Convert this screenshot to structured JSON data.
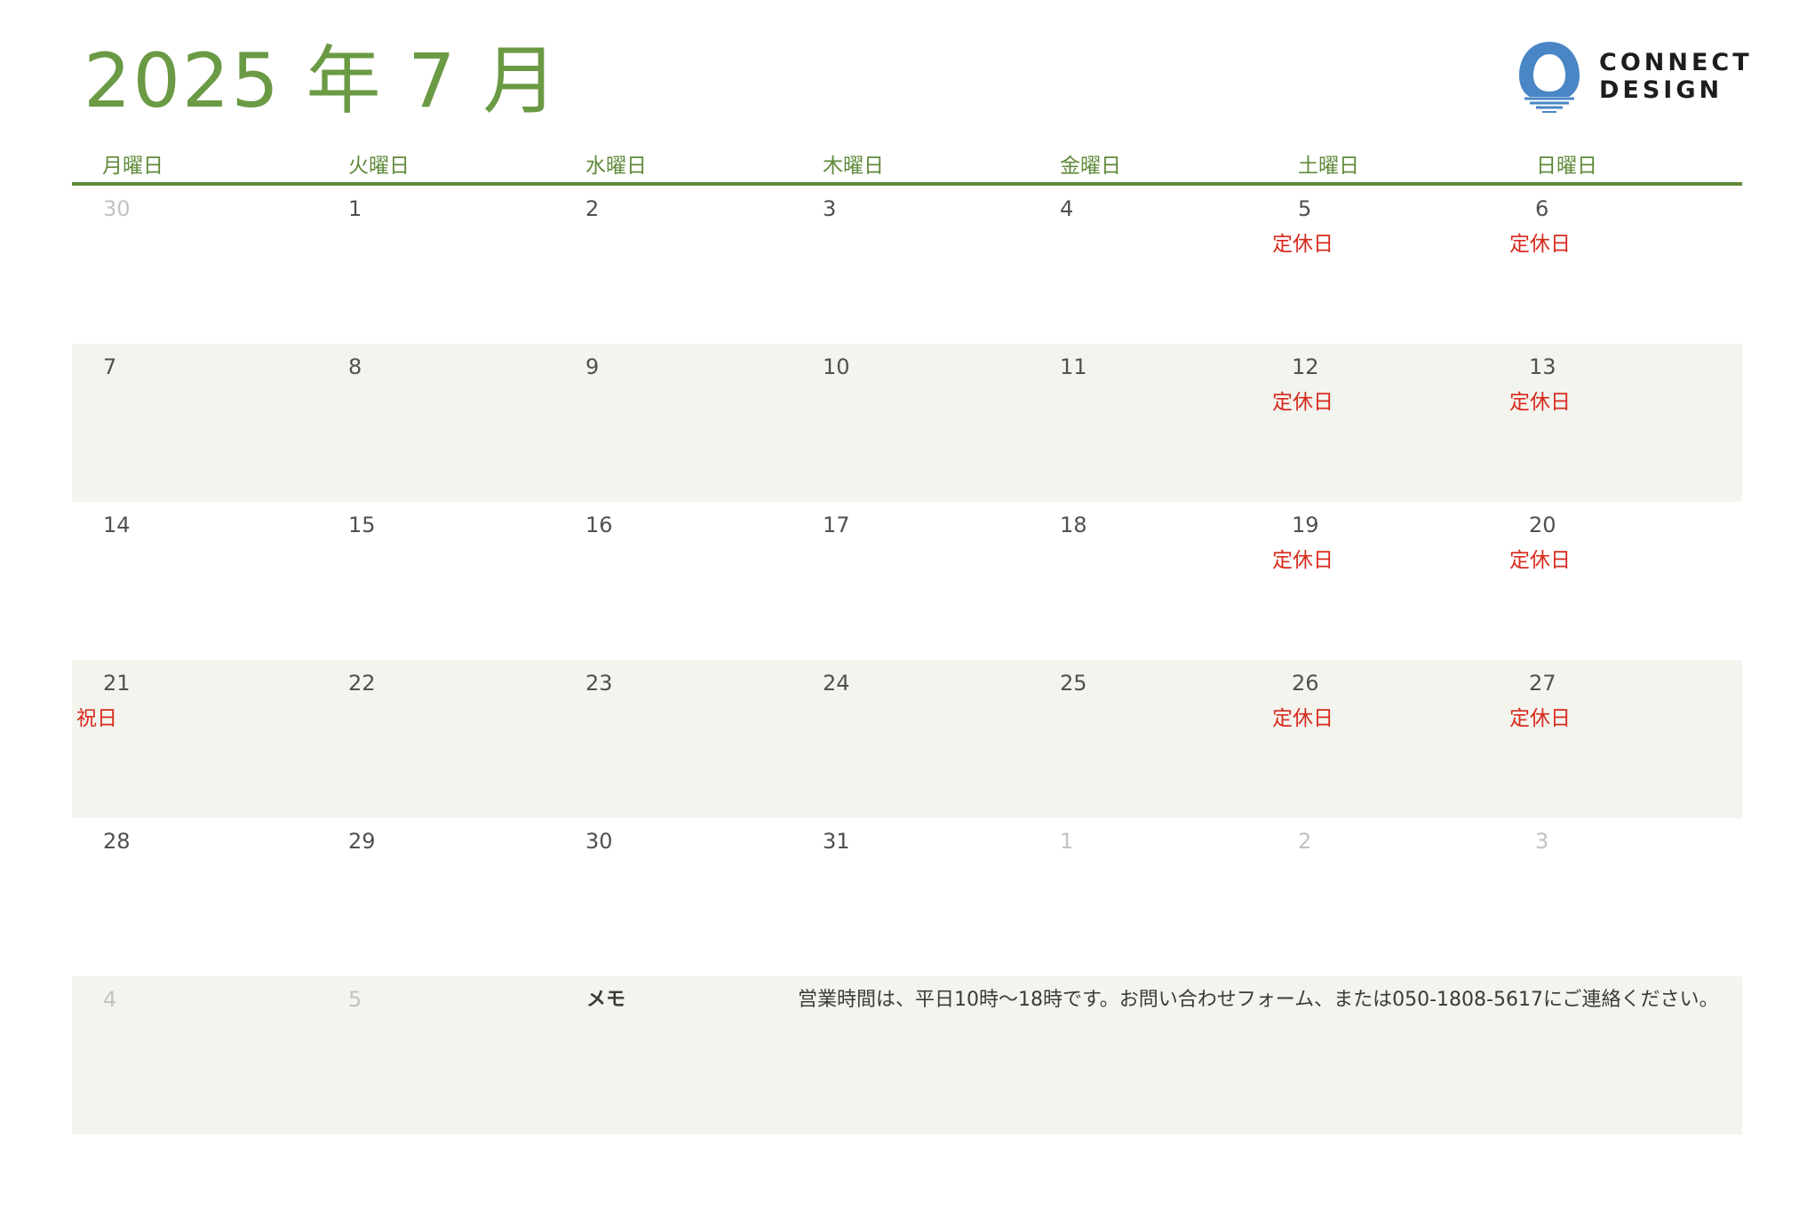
{
  "title": "2025 年 7 月",
  "brand": {
    "line1": "CONNECT",
    "line2": "DESIGN",
    "logo_icon": "connect-design-logo-icon",
    "colors": {
      "logo_blue": "#4a86c5"
    }
  },
  "colors": {
    "accent": "#6b9a45",
    "rule": "#5f8a3a",
    "holiday": "#d72a1c",
    "row_shade": "#f4f4ef",
    "muted": "#c2c2c2"
  },
  "weekdays": [
    "月曜日",
    "火曜日",
    "水曜日",
    "木曜日",
    "金曜日",
    "土曜日",
    "日曜日"
  ],
  "weeks": [
    {
      "days": [
        {
          "day": "30",
          "muted": true
        },
        {
          "day": "1"
        },
        {
          "day": "2"
        },
        {
          "day": "3"
        },
        {
          "day": "4"
        },
        {
          "day": "5",
          "note": "定休日"
        },
        {
          "day": "6",
          "note": "定休日"
        }
      ]
    },
    {
      "days": [
        {
          "day": "7"
        },
        {
          "day": "8"
        },
        {
          "day": "9"
        },
        {
          "day": "10"
        },
        {
          "day": "11"
        },
        {
          "day": "12",
          "note": "定休日"
        },
        {
          "day": "13",
          "note": "定休日"
        }
      ]
    },
    {
      "days": [
        {
          "day": "14"
        },
        {
          "day": "15"
        },
        {
          "day": "16"
        },
        {
          "day": "17"
        },
        {
          "day": "18"
        },
        {
          "day": "19",
          "note": "定休日"
        },
        {
          "day": "20",
          "note": "定休日"
        }
      ]
    },
    {
      "days": [
        {
          "day": "21",
          "note": "祝日"
        },
        {
          "day": "22"
        },
        {
          "day": "23"
        },
        {
          "day": "24"
        },
        {
          "day": "25"
        },
        {
          "day": "26",
          "note": "定休日"
        },
        {
          "day": "27",
          "note": "定休日"
        }
      ]
    },
    {
      "days": [
        {
          "day": "28"
        },
        {
          "day": "29"
        },
        {
          "day": "30"
        },
        {
          "day": "31"
        },
        {
          "day": "1",
          "muted": true
        },
        {
          "day": "2",
          "muted": true
        },
        {
          "day": "3",
          "muted": true
        }
      ]
    }
  ],
  "last_row": {
    "days": [
      {
        "day": "4",
        "muted": true
      },
      {
        "day": "5",
        "muted": true
      }
    ],
    "memo_label": "メモ",
    "memo_text": "営業時間は、平日10時～18時です。お問い合わせフォーム、または050-1808-5617にご連絡ください。"
  }
}
